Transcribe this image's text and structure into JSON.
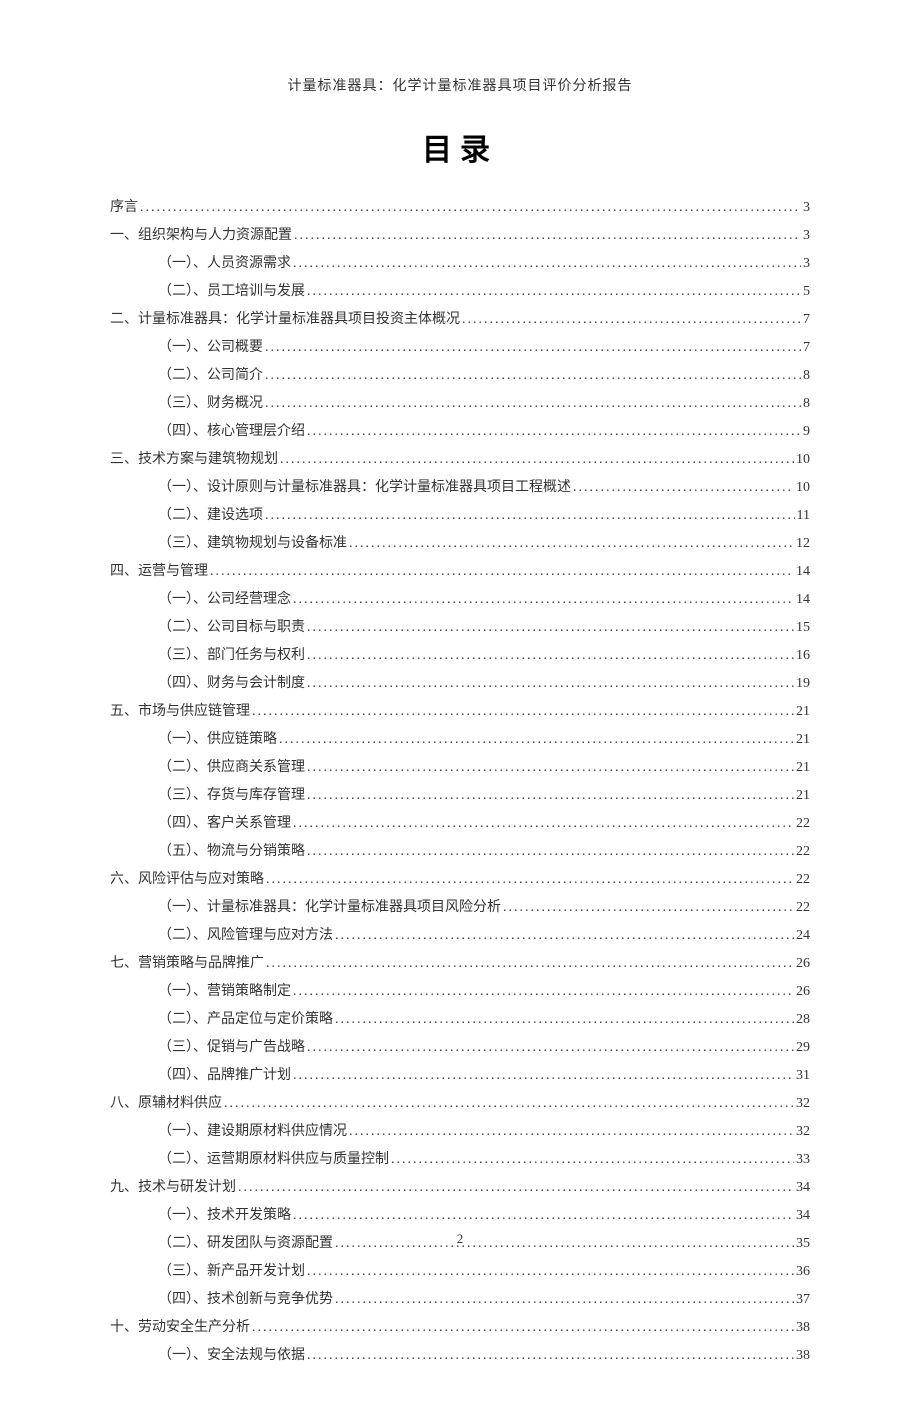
{
  "header": "计量标准器具：化学计量标准器具项目评价分析报告",
  "tocHeading": "目录",
  "pageNumber": "2",
  "entries": [
    {
      "level": 1,
      "label": "序言",
      "page": "3"
    },
    {
      "level": 1,
      "label": "一、组织架构与人力资源配置",
      "page": "3"
    },
    {
      "level": 2,
      "label": "（一）、人员资源需求",
      "page": "3"
    },
    {
      "level": 2,
      "label": "（二）、员工培训与发展",
      "page": "5"
    },
    {
      "level": 1,
      "label": "二、计量标准器具：化学计量标准器具项目投资主体概况",
      "page": "7"
    },
    {
      "level": 2,
      "label": "（一）、公司概要",
      "page": "7"
    },
    {
      "level": 2,
      "label": "（二）、公司简介",
      "page": "8"
    },
    {
      "level": 2,
      "label": "（三）、财务概况",
      "page": "8"
    },
    {
      "level": 2,
      "label": "（四）、核心管理层介绍",
      "page": "9"
    },
    {
      "level": 1,
      "label": "三、技术方案与建筑物规划",
      "page": "10"
    },
    {
      "level": 2,
      "label": "（一）、设计原则与计量标准器具：化学计量标准器具项目工程概述",
      "page": "10"
    },
    {
      "level": 2,
      "label": "（二）、建设选项",
      "page": "11"
    },
    {
      "level": 2,
      "label": "（三）、建筑物规划与设备标准",
      "page": "12"
    },
    {
      "level": 1,
      "label": "四、运营与管理",
      "page": "14"
    },
    {
      "level": 2,
      "label": "（一）、公司经营理念",
      "page": "14"
    },
    {
      "level": 2,
      "label": "（二）、公司目标与职责",
      "page": "15"
    },
    {
      "level": 2,
      "label": "（三）、部门任务与权利",
      "page": "16"
    },
    {
      "level": 2,
      "label": "（四）、财务与会计制度",
      "page": "19"
    },
    {
      "level": 1,
      "label": "五、市场与供应链管理",
      "page": "21"
    },
    {
      "level": 2,
      "label": "（一）、供应链策略",
      "page": "21"
    },
    {
      "level": 2,
      "label": "（二）、供应商关系管理",
      "page": "21"
    },
    {
      "level": 2,
      "label": "（三）、存货与库存管理",
      "page": "21"
    },
    {
      "level": 2,
      "label": "（四）、客户关系管理",
      "page": "22"
    },
    {
      "level": 2,
      "label": "（五）、物流与分销策略",
      "page": "22"
    },
    {
      "level": 1,
      "label": "六、风险评估与应对策略",
      "page": "22"
    },
    {
      "level": 2,
      "label": "（一）、计量标准器具：化学计量标准器具项目风险分析",
      "page": "22"
    },
    {
      "level": 2,
      "label": "（二）、风险管理与应对方法",
      "page": "24"
    },
    {
      "level": 1,
      "label": "七、营销策略与品牌推广",
      "page": "26"
    },
    {
      "level": 2,
      "label": "（一）、营销策略制定",
      "page": "26"
    },
    {
      "level": 2,
      "label": "（二）、产品定位与定价策略",
      "page": "28"
    },
    {
      "level": 2,
      "label": "（三）、促销与广告战略",
      "page": "29"
    },
    {
      "level": 2,
      "label": "（四）、品牌推广计划",
      "page": "31"
    },
    {
      "level": 1,
      "label": "八、原辅材料供应",
      "page": "32"
    },
    {
      "level": 2,
      "label": "（一）、建设期原材料供应情况",
      "page": "32"
    },
    {
      "level": 2,
      "label": "（二）、运营期原材料供应与质量控制",
      "page": "33"
    },
    {
      "level": 1,
      "label": "九、技术与研发计划",
      "page": "34"
    },
    {
      "level": 2,
      "label": "（一）、技术开发策略",
      "page": "34"
    },
    {
      "level": 2,
      "label": "（二）、研发团队与资源配置",
      "page": "35"
    },
    {
      "level": 2,
      "label": "（三）、新产品开发计划",
      "page": "36"
    },
    {
      "level": 2,
      "label": "（四）、技术创新与竞争优势",
      "page": "37"
    },
    {
      "level": 1,
      "label": "十、劳动安全生产分析",
      "page": "38"
    },
    {
      "level": 2,
      "label": "（一）、安全法规与依据",
      "page": "38"
    }
  ]
}
